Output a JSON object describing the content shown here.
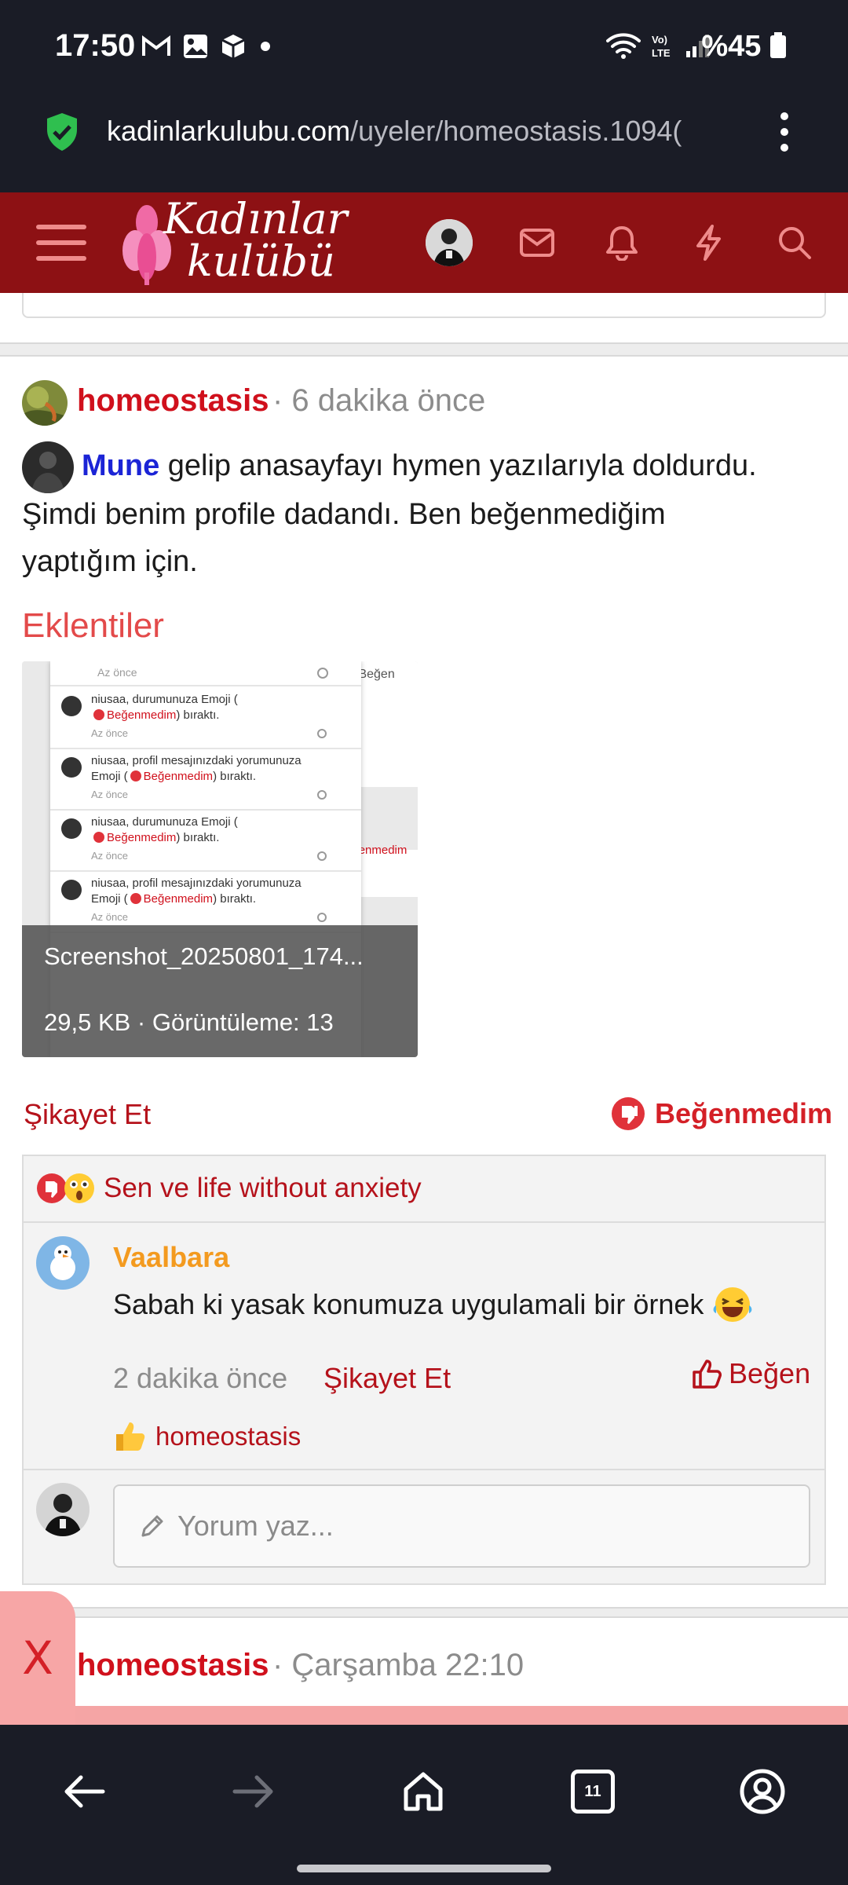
{
  "status_bar": {
    "time": "17:50",
    "battery": "%45",
    "icons": [
      "gmail-icon",
      "gallery-icon",
      "package-icon",
      "dot-icon",
      "wifi-icon",
      "volte-icon",
      "signal-icon",
      "battery-icon"
    ]
  },
  "browser": {
    "url_domain": "kadinlarkulubu.com",
    "url_path": "/uyeler/homeostasis.1094(",
    "tabs_count": "11"
  },
  "site": {
    "logo_line1": "Kadınlar",
    "logo_line2": "kulübü",
    "brand_color": "#8d1114"
  },
  "post": {
    "author": "homeostasis",
    "time": "· 6 dakika önce",
    "mention": "Mune",
    "text_line1": " gelip anasayfayı hymen yazılarıyla doldurdu.",
    "text_line2": "Şimdi benim profile dadandı. Ben beğenmediğim",
    "text_line3": "yaptığım için.",
    "attachments_title": "Eklentiler",
    "attachment": {
      "filename": "Screenshot_20250801_174...",
      "meta": "29,5 KB · Görüntüleme: 13",
      "thumb_rows": [
        {
          "name": "niusaa, durumunuza Emoji (",
          "reaction": "Beğenmedim",
          "suffix": ") bıraktı.",
          "time": "Az önce"
        },
        {
          "name": "niusaa, profil mesajınızdaki yorumunuza",
          "reaction": "Beğenmedim",
          "prefix": "Emoji (",
          "suffix": ") bıraktı.",
          "time": "Az önce"
        },
        {
          "name": "niusaa, durumunuza Emoji (",
          "reaction": "Beğenmedim",
          "suffix": ") bıraktı.",
          "time": "Az önce"
        },
        {
          "name": "niusaa, profil mesajınızdaki yorumunuza",
          "reaction": "Beğenmedim",
          "prefix": "Emoji (",
          "suffix": ") bıraktı.",
          "time": "Az önce"
        }
      ],
      "thumb_top_time": "Az önce",
      "thumb_like": "Beğen",
      "thumb_dislike": "Beğenmedim"
    },
    "report_label": "Şikayet Et",
    "dislike_label": "Beğenmedim"
  },
  "reactions": {
    "summary": "Sen ve life without anxiety"
  },
  "comment": {
    "author": "Vaalbara",
    "text": "Sabah ki yasak konumuza uygulamali bir örnek",
    "time": "2 dakika önce",
    "report_label": "Şikayet Et",
    "like_label": "Beğen",
    "liked_by": "homeostasis"
  },
  "reply": {
    "placeholder": "Yorum yaz..."
  },
  "next_post": {
    "close_label": "X",
    "author": "homeostasis",
    "time": "· Çarşamba 22:10"
  }
}
